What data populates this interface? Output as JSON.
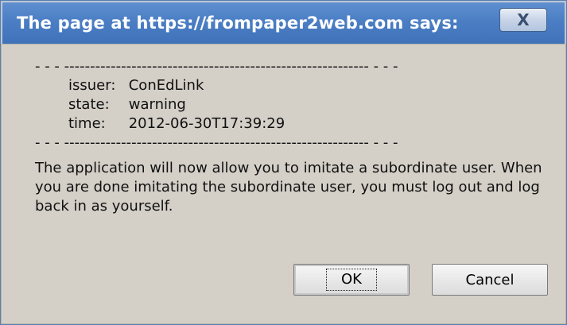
{
  "dialog": {
    "title": "The page at https://frompaper2web.com says:",
    "close_label": "X"
  },
  "message": {
    "divider_top": "- - - ----------------------------------------------------------- - - -",
    "details": [
      {
        "key": "issuer:",
        "value": "ConEdLink"
      },
      {
        "key": "state:",
        "value": "warning"
      },
      {
        "key": "time:",
        "value": "2012-06-30T17:39:29"
      }
    ],
    "divider_bottom": "- - - ----------------------------------------------------------- - - -",
    "paragraph": "The application will now allow you to imitate a subordinate user. When you are done imitating the subordinate user, you must log out and log back in as yourself."
  },
  "buttons": {
    "ok_label": "OK",
    "cancel_label": "Cancel"
  },
  "colors": {
    "titlebar": "#4b7ec4",
    "dialog_background": "#d4d0c8"
  },
  "icons": {
    "close": "close-icon"
  }
}
